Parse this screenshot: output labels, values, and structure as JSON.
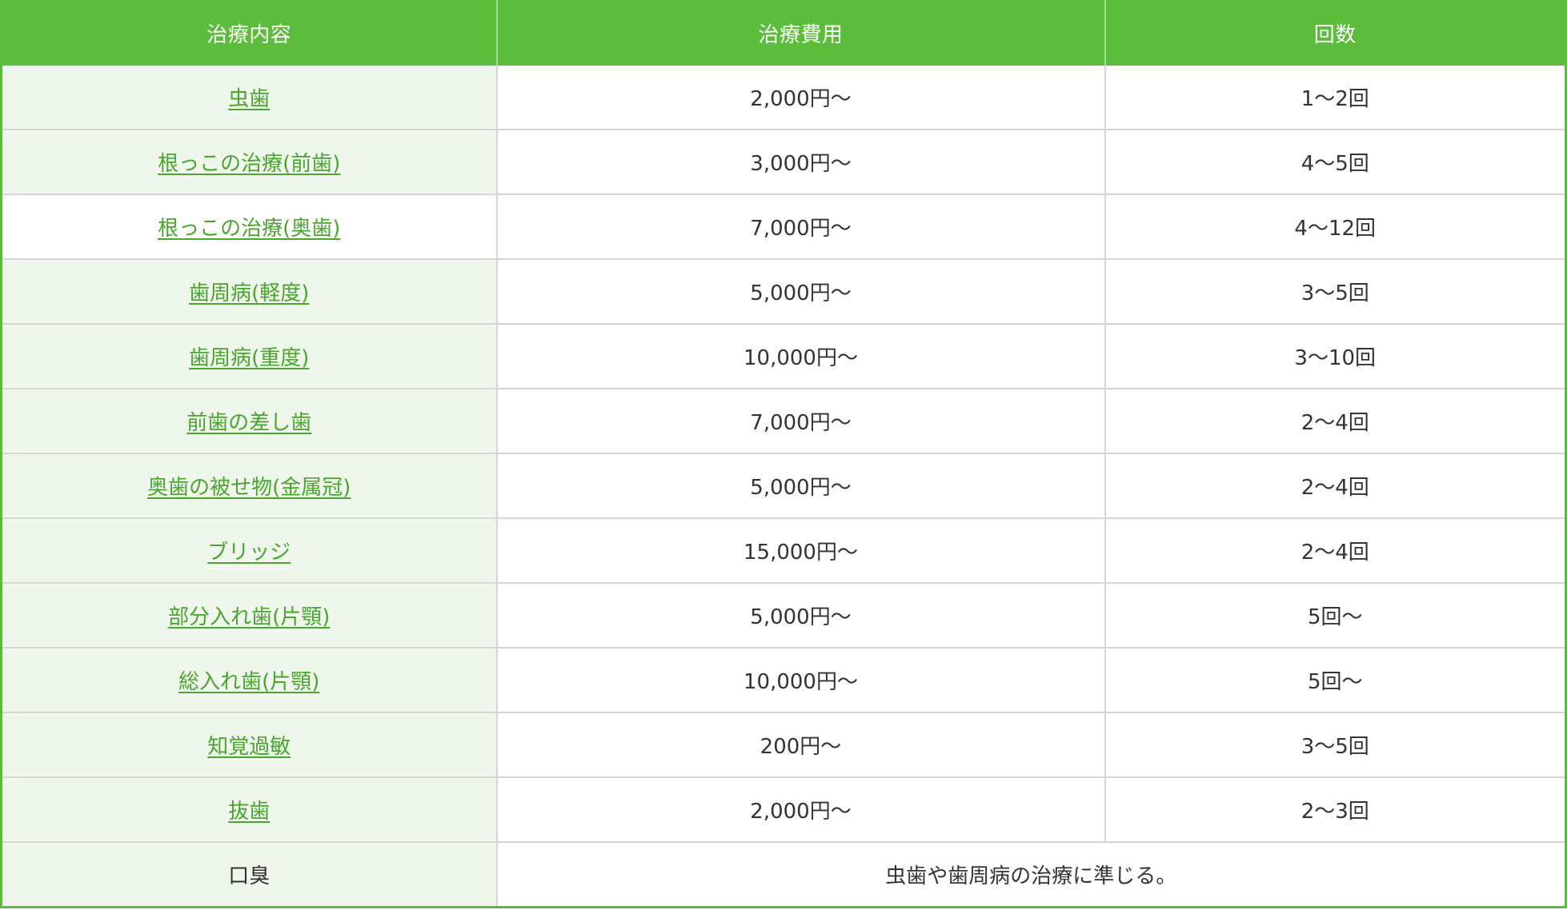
{
  "table": {
    "headers": [
      "治療内容",
      "治療費用",
      "回数"
    ],
    "rows": [
      {
        "treatment": "虫歯",
        "fee": "2,000円〜",
        "visits": "1〜2回",
        "link": true
      },
      {
        "treatment": "根っこの治療(前歯)",
        "fee": "3,000円〜",
        "visits": "4〜5回",
        "link": true
      },
      {
        "treatment": "根っこの治療(奥歯)",
        "fee": "7,000円〜",
        "visits": "4〜12回",
        "link": true,
        "plain_bg": true
      },
      {
        "treatment": "歯周病(軽度)",
        "fee": "5,000円〜",
        "visits": "3〜5回",
        "link": true
      },
      {
        "treatment": "歯周病(重度)",
        "fee": "10,000円〜",
        "visits": "3〜10回",
        "link": true
      },
      {
        "treatment": "前歯の差し歯",
        "fee": "7,000円〜",
        "visits": "2〜4回",
        "link": true
      },
      {
        "treatment": "奥歯の被せ物(金属冠)",
        "fee": "5,000円〜",
        "visits": "2〜4回",
        "link": true
      },
      {
        "treatment": "ブリッジ",
        "fee": "15,000円〜",
        "visits": "2〜4回",
        "link": true
      },
      {
        "treatment": "部分入れ歯(片顎)",
        "fee": "5,000円〜",
        "visits": "5回〜",
        "link": true
      },
      {
        "treatment": "総入れ歯(片顎)",
        "fee": "10,000円〜",
        "visits": "5回〜",
        "link": true
      },
      {
        "treatment": "知覚過敏",
        "fee": "200円〜",
        "visits": "3〜5回",
        "link": true
      },
      {
        "treatment": "抜歯",
        "fee": "2,000円〜",
        "visits": "2〜3回",
        "link": true
      }
    ],
    "footer_row": {
      "treatment": "口臭",
      "note": "虫歯や歯周病の治療に準じる。"
    }
  },
  "colors": {
    "header_bg": "#5cbd3c",
    "name_cell_bg": "#eff7ed",
    "link_color": "#4aa52e"
  }
}
